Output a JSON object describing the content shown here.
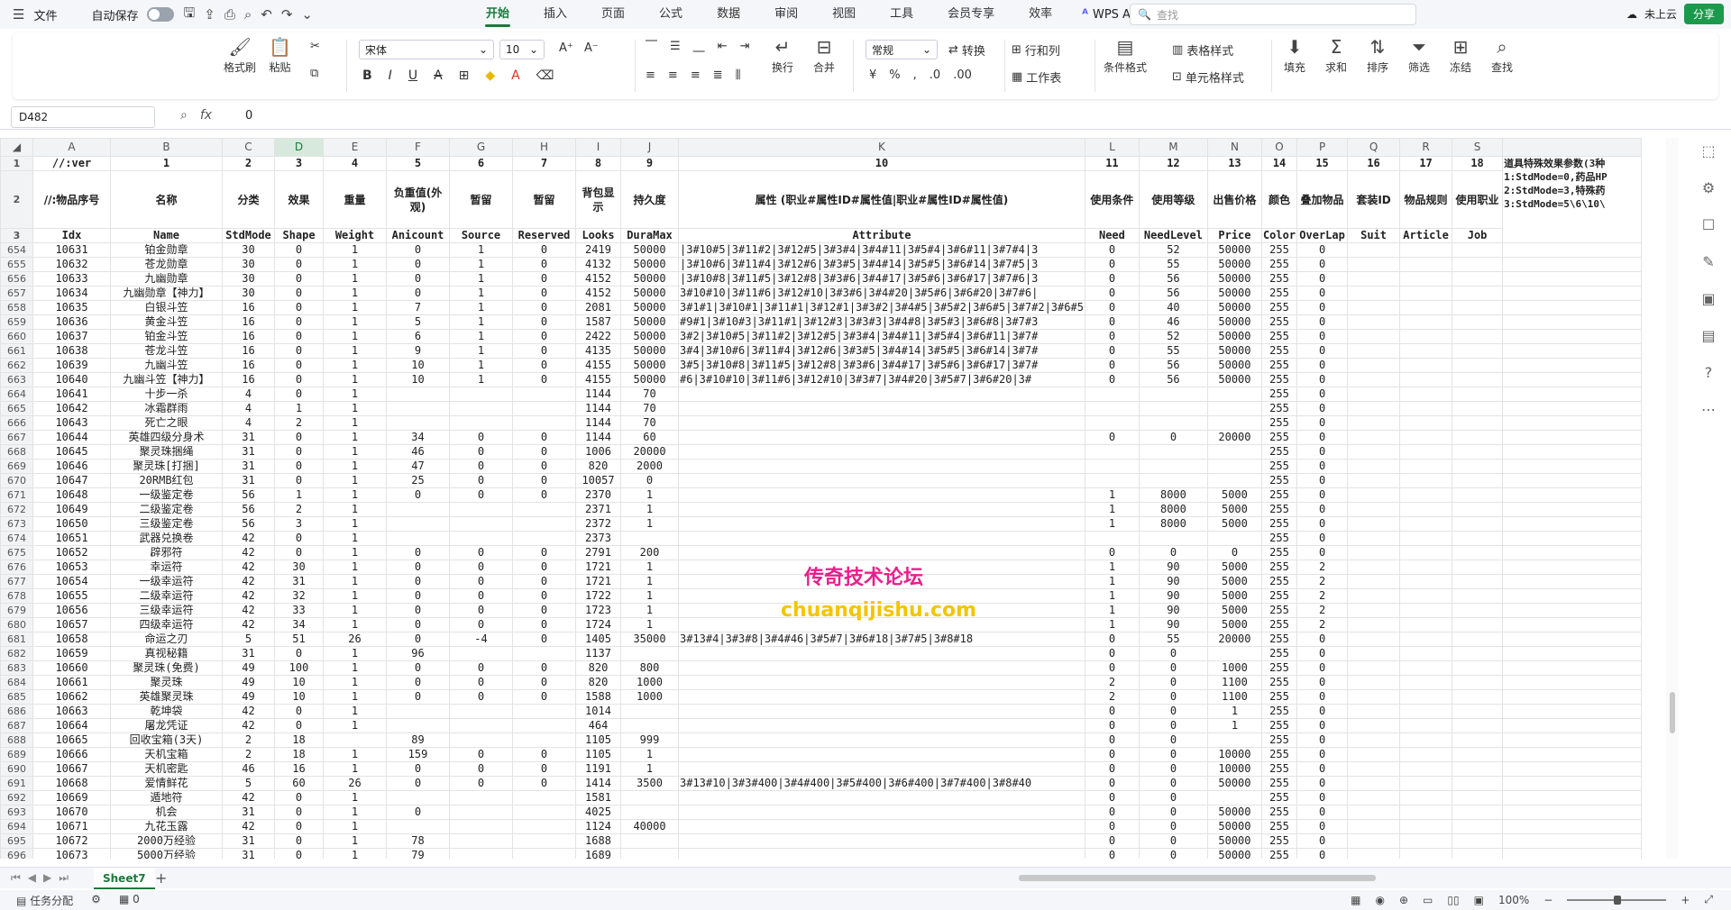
{
  "menu": {
    "file": "文件",
    "autosave": "自动保存",
    "tabs": [
      "开始",
      "插入",
      "页面",
      "公式",
      "数据",
      "审阅",
      "视图",
      "工具",
      "会员专享",
      "效率"
    ],
    "wps_ai": "WPS AI",
    "search_placeholder": "查找",
    "cloud": "未上云",
    "share": "分享"
  },
  "ribbon": {
    "format_painter": "格式刷",
    "paste": "粘贴",
    "font_name": "宋体",
    "font_size": "10",
    "wrap": "换行",
    "merge": "合并",
    "number_format": "常规",
    "convert": "转换",
    "rows_cols": "行和列",
    "worksheet": "工作表",
    "cond_format": "条件格式",
    "table_style": "表格样式",
    "cell_style": "单元格样式",
    "fill": "填充",
    "sum": "求和",
    "sort": "排序",
    "filter": "筛选",
    "freeze": "冻结",
    "find": "查找"
  },
  "formula_bar": {
    "cell_ref": "D482",
    "value": "0"
  },
  "grid": {
    "columns": [
      "A",
      "B",
      "C",
      "D",
      "E",
      "F",
      "G",
      "H",
      "I",
      "J",
      "K",
      "L",
      "M",
      "N",
      "O",
      "P",
      "Q",
      "R",
      "S"
    ],
    "header_rows": [
      [
        "1",
        "//:ver",
        "1",
        "2",
        "3",
        "4",
        "5",
        "6",
        "7",
        "8",
        "9",
        "10",
        "11",
        "12",
        "13",
        "14",
        "15",
        "16",
        "17",
        "18",
        "道具特殊效果参数(3种\n1:StdMode=0,药品HP\n2:StdMode=3,特殊药\n3:StdMode=5\\6\\10\\"
      ],
      [
        "2",
        "//:物品序号",
        "名称",
        "分类",
        "效果",
        "重量",
        "负重值(外观)",
        "暂留",
        "暂留",
        "背包显示",
        "持久度",
        "属性 (职业#属性ID#属性值|职业#属性ID#属性值)",
        "使用条件",
        "使用等级",
        "出售价格",
        "颜色",
        "叠加物品",
        "套装ID",
        "物品规则",
        "使用职业",
        ""
      ],
      [
        "3",
        "Idx",
        "Name",
        "StdMode",
        "Shape",
        "Weight",
        "Anicount",
        "Source",
        "Reserved",
        "Looks",
        "DuraMax",
        "Attribute",
        "Need",
        "NeedLevel",
        "Price",
        "Color",
        "OverLap",
        "Suit",
        "Article",
        "Job",
        ""
      ]
    ],
    "rows": [
      [
        "654",
        "10631",
        "铂金勋章",
        "30",
        "0",
        "1",
        "0",
        "1",
        "0",
        "2419",
        "50000",
        "|3#10#5|3#11#2|3#12#5|3#3#4|3#4#11|3#5#4|3#6#11|3#7#4|3",
        "0",
        "52",
        "50000",
        "255",
        "0",
        "",
        "",
        "",
        ""
      ],
      [
        "655",
        "10632",
        "苍龙勋章",
        "30",
        "0",
        "1",
        "0",
        "1",
        "0",
        "4132",
        "50000",
        "|3#10#6|3#11#4|3#12#6|3#3#5|3#4#14|3#5#5|3#6#14|3#7#5|3",
        "0",
        "55",
        "50000",
        "255",
        "0",
        "",
        "",
        "",
        ""
      ],
      [
        "656",
        "10633",
        "九幽勋章",
        "30",
        "0",
        "1",
        "0",
        "1",
        "0",
        "4152",
        "50000",
        "|3#10#8|3#11#5|3#12#8|3#3#6|3#4#17|3#5#6|3#6#17|3#7#6|3",
        "0",
        "56",
        "50000",
        "255",
        "0",
        "",
        "",
        "",
        ""
      ],
      [
        "657",
        "10634",
        "九幽勋章【神力】",
        "30",
        "0",
        "1",
        "0",
        "1",
        "0",
        "4152",
        "50000",
        "3#10#10|3#11#6|3#12#10|3#3#6|3#4#20|3#5#6|3#6#20|3#7#6|",
        "0",
        "56",
        "50000",
        "255",
        "0",
        "",
        "",
        "",
        ""
      ],
      [
        "658",
        "10635",
        "白银斗笠",
        "16",
        "0",
        "1",
        "7",
        "1",
        "0",
        "2081",
        "50000",
        "3#1#1|3#10#1|3#11#1|3#12#1|3#3#2|3#4#5|3#5#2|3#6#5|3#7#2|3#6#5",
        "0",
        "40",
        "50000",
        "255",
        "0",
        "",
        "",
        "",
        ""
      ],
      [
        "659",
        "10636",
        "黄金斗笠",
        "16",
        "0",
        "1",
        "5",
        "1",
        "0",
        "1587",
        "50000",
        "#9#1|3#10#3|3#11#1|3#12#3|3#3#3|3#4#8|3#5#3|3#6#8|3#7#3",
        "0",
        "46",
        "50000",
        "255",
        "0",
        "",
        "",
        "",
        ""
      ],
      [
        "660",
        "10637",
        "铂金斗笠",
        "16",
        "0",
        "1",
        "6",
        "1",
        "0",
        "2422",
        "50000",
        "3#2|3#10#5|3#11#2|3#12#5|3#3#4|3#4#11|3#5#4|3#6#11|3#7#",
        "0",
        "52",
        "50000",
        "255",
        "0",
        "",
        "",
        "",
        ""
      ],
      [
        "661",
        "10638",
        "苍龙斗笠",
        "16",
        "0",
        "1",
        "9",
        "1",
        "0",
        "4135",
        "50000",
        "3#4|3#10#6|3#11#4|3#12#6|3#3#5|3#4#14|3#5#5|3#6#14|3#7#",
        "0",
        "55",
        "50000",
        "255",
        "0",
        "",
        "",
        "",
        ""
      ],
      [
        "662",
        "10639",
        "九幽斗笠",
        "16",
        "0",
        "1",
        "10",
        "1",
        "0",
        "4155",
        "50000",
        "3#5|3#10#8|3#11#5|3#12#8|3#3#6|3#4#17|3#5#6|3#6#17|3#7#",
        "0",
        "56",
        "50000",
        "255",
        "0",
        "",
        "",
        "",
        ""
      ],
      [
        "663",
        "10640",
        "九幽斗笠【神力】",
        "16",
        "0",
        "1",
        "10",
        "1",
        "0",
        "4155",
        "50000",
        "#6|3#10#10|3#11#6|3#12#10|3#3#7|3#4#20|3#5#7|3#6#20|3#",
        "0",
        "56",
        "50000",
        "255",
        "0",
        "",
        "",
        "",
        ""
      ],
      [
        "664",
        "10641",
        "十步一杀",
        "4",
        "0",
        "1",
        "",
        "",
        "",
        "1144",
        "70",
        "",
        "",
        "",
        "",
        "255",
        "0",
        "",
        "",
        "",
        ""
      ],
      [
        "665",
        "10642",
        "冰霜群雨",
        "4",
        "1",
        "1",
        "",
        "",
        "",
        "1144",
        "70",
        "",
        "",
        "",
        "",
        "255",
        "0",
        "",
        "",
        "",
        ""
      ],
      [
        "666",
        "10643",
        "死亡之眼",
        "4",
        "2",
        "1",
        "",
        "",
        "",
        "1144",
        "70",
        "",
        "",
        "",
        "",
        "255",
        "0",
        "",
        "",
        "",
        ""
      ],
      [
        "667",
        "10644",
        "英雄四级分身术",
        "31",
        "0",
        "1",
        "34",
        "0",
        "0",
        "1144",
        "60",
        "",
        "0",
        "0",
        "20000",
        "255",
        "0",
        "",
        "",
        "",
        ""
      ],
      [
        "668",
        "10645",
        "聚灵珠捆绳",
        "31",
        "0",
        "1",
        "46",
        "0",
        "0",
        "1006",
        "20000",
        "",
        "",
        "",
        "",
        "255",
        "0",
        "",
        "",
        "",
        ""
      ],
      [
        "669",
        "10646",
        "聚灵珠[打捆]",
        "31",
        "0",
        "1",
        "47",
        "0",
        "0",
        "820",
        "2000",
        "",
        "",
        "",
        "",
        "255",
        "0",
        "",
        "",
        "",
        ""
      ],
      [
        "670",
        "10647",
        "20RMB红包",
        "31",
        "0",
        "1",
        "25",
        "0",
        "0",
        "10057",
        "0",
        "",
        "",
        "",
        "",
        "255",
        "0",
        "",
        "",
        "",
        ""
      ],
      [
        "671",
        "10648",
        "一级鉴定卷",
        "56",
        "1",
        "1",
        "0",
        "0",
        "0",
        "2370",
        "1",
        "",
        "1",
        "8000",
        "5000",
        "255",
        "0",
        "",
        "",
        "",
        ""
      ],
      [
        "672",
        "10649",
        "二级鉴定卷",
        "56",
        "2",
        "1",
        "",
        "",
        "",
        "2371",
        "1",
        "",
        "1",
        "8000",
        "5000",
        "255",
        "0",
        "",
        "",
        "",
        ""
      ],
      [
        "673",
        "10650",
        "三级鉴定卷",
        "56",
        "3",
        "1",
        "",
        "",
        "",
        "2372",
        "1",
        "",
        "1",
        "8000",
        "5000",
        "255",
        "0",
        "",
        "",
        "",
        ""
      ],
      [
        "674",
        "10651",
        "武器兑换卷",
        "42",
        "0",
        "1",
        "",
        "",
        "",
        "2373",
        "",
        "",
        "",
        "",
        "",
        "255",
        "0",
        "",
        "",
        "",
        ""
      ],
      [
        "675",
        "10652",
        "辟邪符",
        "42",
        "0",
        "1",
        "0",
        "0",
        "0",
        "2791",
        "200",
        "",
        "0",
        "0",
        "0",
        "255",
        "0",
        "",
        "",
        "",
        ""
      ],
      [
        "676",
        "10653",
        "幸运符",
        "42",
        "30",
        "1",
        "0",
        "0",
        "0",
        "1721",
        "1",
        "",
        "1",
        "90",
        "5000",
        "255",
        "2",
        "",
        "",
        "",
        ""
      ],
      [
        "677",
        "10654",
        "一级幸运符",
        "42",
        "31",
        "1",
        "0",
        "0",
        "0",
        "1721",
        "1",
        "",
        "1",
        "90",
        "5000",
        "255",
        "2",
        "",
        "",
        "",
        ""
      ],
      [
        "678",
        "10655",
        "二级幸运符",
        "42",
        "32",
        "1",
        "0",
        "0",
        "0",
        "1722",
        "1",
        "",
        "1",
        "90",
        "5000",
        "255",
        "2",
        "",
        "",
        "",
        ""
      ],
      [
        "679",
        "10656",
        "三级幸运符",
        "42",
        "33",
        "1",
        "0",
        "0",
        "0",
        "1723",
        "1",
        "",
        "1",
        "90",
        "5000",
        "255",
        "2",
        "",
        "",
        "",
        ""
      ],
      [
        "680",
        "10657",
        "四级幸运符",
        "42",
        "34",
        "1",
        "0",
        "0",
        "0",
        "1724",
        "1",
        "",
        "1",
        "90",
        "5000",
        "255",
        "2",
        "",
        "",
        "",
        ""
      ],
      [
        "681",
        "10658",
        "命运之刃",
        "5",
        "51",
        "26",
        "0",
        "-4",
        "0",
        "1405",
        "35000",
        "3#13#4|3#3#8|3#4#46|3#5#7|3#6#18|3#7#5|3#8#18",
        "0",
        "55",
        "20000",
        "255",
        "0",
        "",
        "",
        "",
        ""
      ],
      [
        "682",
        "10659",
        "真视秘籍",
        "31",
        "0",
        "1",
        "96",
        "",
        "",
        "1137",
        "",
        "",
        "0",
        "0",
        "",
        "255",
        "0",
        "",
        "",
        "",
        ""
      ],
      [
        "683",
        "10660",
        "聚灵珠(免费)",
        "49",
        "100",
        "1",
        "0",
        "0",
        "0",
        "820",
        "800",
        "",
        "0",
        "0",
        "1000",
        "255",
        "0",
        "",
        "",
        "",
        ""
      ],
      [
        "684",
        "10661",
        "聚灵珠",
        "49",
        "10",
        "1",
        "0",
        "0",
        "0",
        "820",
        "1000",
        "",
        "2",
        "0",
        "1100",
        "255",
        "0",
        "",
        "",
        "",
        ""
      ],
      [
        "685",
        "10662",
        "英雄聚灵珠",
        "49",
        "10",
        "1",
        "0",
        "0",
        "0",
        "1588",
        "1000",
        "",
        "2",
        "0",
        "1100",
        "255",
        "0",
        "",
        "",
        "",
        ""
      ],
      [
        "686",
        "10663",
        "乾坤袋",
        "42",
        "0",
        "1",
        "",
        "",
        "",
        "1014",
        "",
        "",
        "0",
        "0",
        "1",
        "255",
        "0",
        "",
        "",
        "",
        ""
      ],
      [
        "687",
        "10664",
        "屠龙凭证",
        "42",
        "0",
        "1",
        "",
        "",
        "",
        "464",
        "",
        "",
        "0",
        "0",
        "1",
        "255",
        "0",
        "",
        "",
        "",
        ""
      ],
      [
        "688",
        "10665",
        "回收宝箱(3天)",
        "2",
        "18",
        "",
        "89",
        "",
        "",
        "1105",
        "999",
        "",
        "0",
        "0",
        "",
        "255",
        "0",
        "",
        "",
        "",
        ""
      ],
      [
        "689",
        "10666",
        "天机宝箱",
        "2",
        "18",
        "1",
        "159",
        "0",
        "0",
        "1105",
        "1",
        "",
        "0",
        "0",
        "10000",
        "255",
        "0",
        "",
        "",
        "",
        ""
      ],
      [
        "690",
        "10667",
        "天机密匙",
        "46",
        "16",
        "1",
        "0",
        "0",
        "0",
        "1191",
        "1",
        "",
        "0",
        "0",
        "10000",
        "255",
        "0",
        "",
        "",
        "",
        ""
      ],
      [
        "691",
        "10668",
        "爱情鲜花",
        "5",
        "60",
        "26",
        "0",
        "0",
        "0",
        "1414",
        "3500",
        "3#13#10|3#3#400|3#4#400|3#5#400|3#6#400|3#7#400|3#8#40",
        "0",
        "0",
        "50000",
        "255",
        "0",
        "",
        "",
        "",
        ""
      ],
      [
        "692",
        "10669",
        "遁地符",
        "42",
        "0",
        "1",
        "",
        "",
        "",
        "1581",
        "",
        "",
        "0",
        "0",
        "",
        "255",
        "0",
        "",
        "",
        "",
        ""
      ],
      [
        "693",
        "10670",
        "机会",
        "31",
        "0",
        "1",
        "0",
        "",
        "",
        "4025",
        "",
        "",
        "0",
        "0",
        "50000",
        "255",
        "0",
        "",
        "",
        "",
        ""
      ],
      [
        "694",
        "10671",
        "九花玉露",
        "42",
        "0",
        "1",
        "",
        "",
        "",
        "1124",
        "40000",
        "",
        "0",
        "0",
        "50000",
        "255",
        "0",
        "",
        "",
        "",
        ""
      ],
      [
        "695",
        "10672",
        "2000万经验",
        "31",
        "0",
        "1",
        "78",
        "",
        "",
        "1688",
        "",
        "",
        "0",
        "0",
        "50000",
        "255",
        "0",
        "",
        "",
        "",
        ""
      ],
      [
        "696",
        "10673",
        "5000万经验",
        "31",
        "0",
        "1",
        "79",
        "",
        "",
        "1689",
        "",
        "",
        "0",
        "0",
        "50000",
        "255",
        "0",
        "",
        "",
        "",
        ""
      ]
    ]
  },
  "watermark": {
    "cn": "传奇技术论坛",
    "url": "chuanqijishu.com"
  },
  "sheet_tabs": [
    "Sheet7"
  ],
  "status": {
    "task": "任务分配",
    "cell_count": "0",
    "zoom": "100%"
  }
}
